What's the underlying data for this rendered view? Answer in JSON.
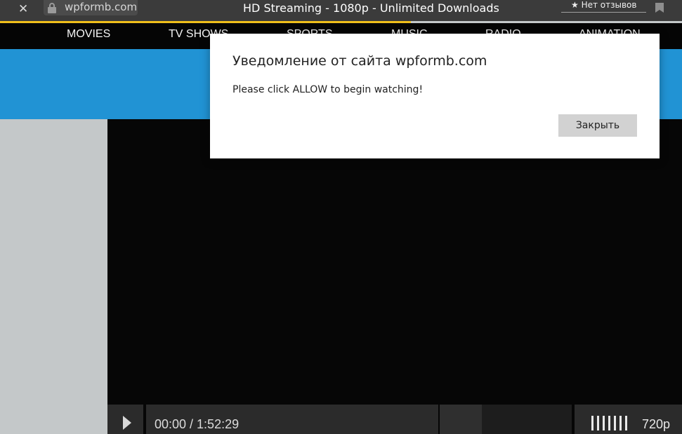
{
  "browser": {
    "close_symbol": "✕",
    "url": "wpformb.com",
    "page_title": "HD Streaming - 1080p - Unlimited Downloads",
    "reviews_label": "★ Нет отзывов",
    "icons": [
      "close-icon",
      "lock-icon",
      "bookmark-icon"
    ]
  },
  "nav": {
    "items": [
      "MOVIES",
      "TV SHOWS",
      "SPORTS",
      "MUSIC",
      "RADIO",
      "ANIMATION"
    ]
  },
  "player": {
    "time": "00:00 / 1:52:29",
    "quality": "720p",
    "icons": [
      "play-icon",
      "volume-bars-icon"
    ]
  },
  "dialog": {
    "title": "Уведомление от сайта wpformb.com",
    "message": "Please click ALLOW to begin watching!",
    "close_label": "Закрыть"
  },
  "colors": {
    "banner": "#2193d4",
    "load_bar": "#f0bf1b",
    "nav_bg": "#050505",
    "sidebar_gray": "#c4c8c9"
  }
}
